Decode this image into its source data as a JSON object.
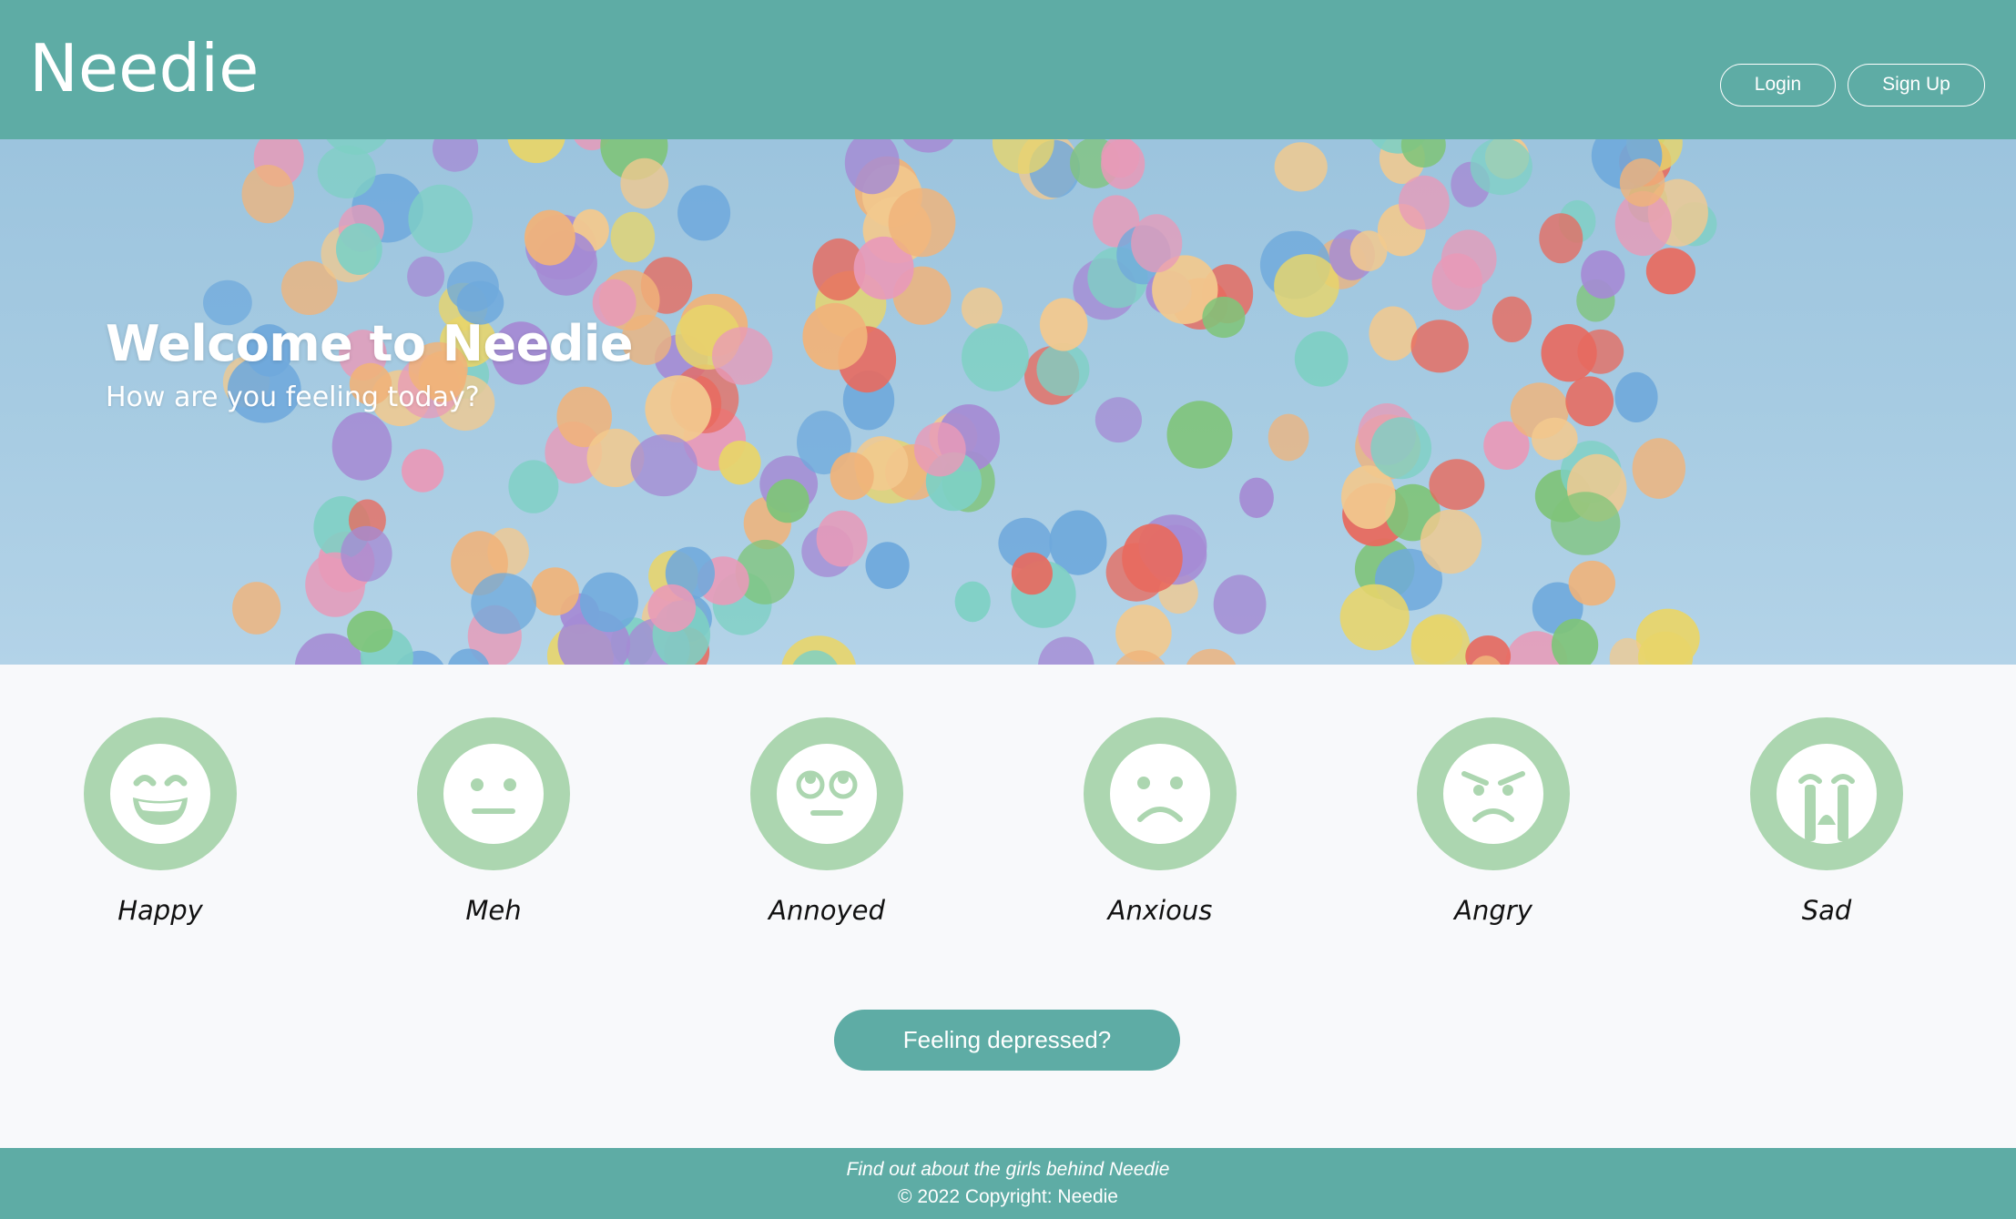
{
  "header": {
    "brand": "Needie",
    "login_label": "Login",
    "signup_label": "Sign Up"
  },
  "hero": {
    "title": "Welcome to Needie",
    "subtitle": "How are you feeling today?",
    "image": "balloons-in-sky"
  },
  "moods": [
    {
      "label": "Happy",
      "icon": "grin-icon"
    },
    {
      "label": "Meh",
      "icon": "neutral-face-icon"
    },
    {
      "label": "Annoyed",
      "icon": "eye-roll-icon"
    },
    {
      "label": "Anxious",
      "icon": "frown-icon"
    },
    {
      "label": "Angry",
      "icon": "angry-face-icon"
    },
    {
      "label": "Sad",
      "icon": "crying-face-icon"
    }
  ],
  "cta": {
    "label": "Feeling depressed?"
  },
  "footer": {
    "link_text": "Find out about the girls behind Needie",
    "copyright": "© 2022 Copyright: Needie"
  },
  "colors": {
    "primary": "#5eaca5",
    "mood_circle": "#acd6b0",
    "background": "#f8f9fb"
  }
}
